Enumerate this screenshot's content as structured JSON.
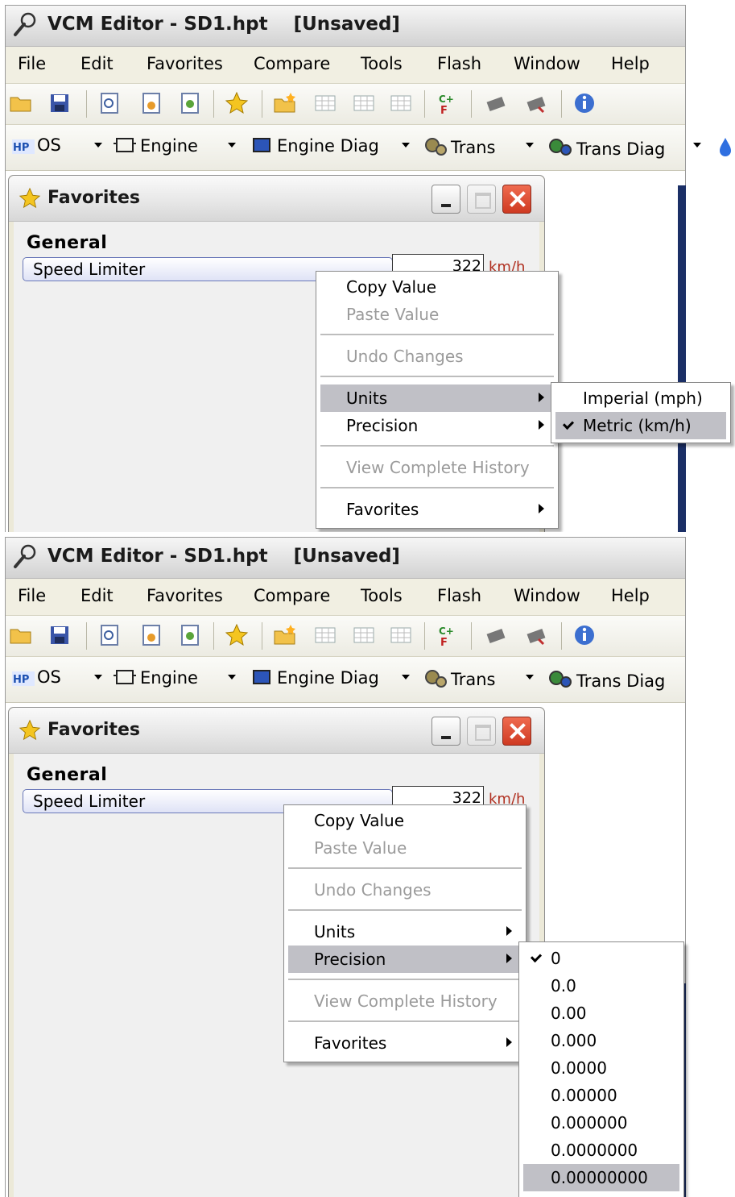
{
  "window": {
    "title": "VCM Editor - SD1.hpt    [Unsaved]"
  },
  "menubar": [
    "File",
    "Edit",
    "Favorites",
    "Compare",
    "Tools",
    "Flash",
    "Window",
    "Help"
  ],
  "toolbar_icons": [
    "open-folder",
    "save",
    "document-search",
    "document-a",
    "document-b",
    "star",
    "folder-new",
    "table-a",
    "table-b",
    "table-c",
    "compare-cf",
    "chip-read",
    "chip-write",
    "info"
  ],
  "module_toolbar": {
    "items": [
      {
        "label": "OS",
        "icon": "hp-os-icon"
      },
      {
        "label": "Engine",
        "icon": "engine-icon"
      },
      {
        "label": "Engine Diag",
        "icon": "engine-diag-icon"
      },
      {
        "label": "Trans",
        "icon": "trans-gear-icon"
      },
      {
        "label": "Trans Diag",
        "icon": "trans-diag-icon"
      }
    ],
    "overflow_icon": "fuel-drop-icon"
  },
  "favorites_window": {
    "title": "Favorites",
    "group_label": "General",
    "row_label": "Speed Limiter",
    "value_top": "322",
    "value_bottom": "322",
    "unit": "km/h"
  },
  "context_menu": {
    "copy_value": "Copy Value",
    "paste_value": "Paste Value",
    "undo_changes": "Undo Changes",
    "units": "Units",
    "precision": "Precision",
    "view_history": "View Complete History",
    "favorites": "Favorites"
  },
  "units_submenu": {
    "imperial": "Imperial (mph)",
    "metric": "Metric (km/h)",
    "checked": "metric"
  },
  "precision_submenu": {
    "options": [
      "0",
      "0.0",
      "0.00",
      "0.000",
      "0.0000",
      "0.00000",
      "0.000000",
      "0.0000000",
      "0.00000000"
    ],
    "checked": "0",
    "highlighted": "0.00000000"
  },
  "colors": {
    "highlight": "#c0c0c6",
    "close_button": "#d9452c",
    "row_border": "#6a78b8",
    "unit_text": "#b03020"
  }
}
